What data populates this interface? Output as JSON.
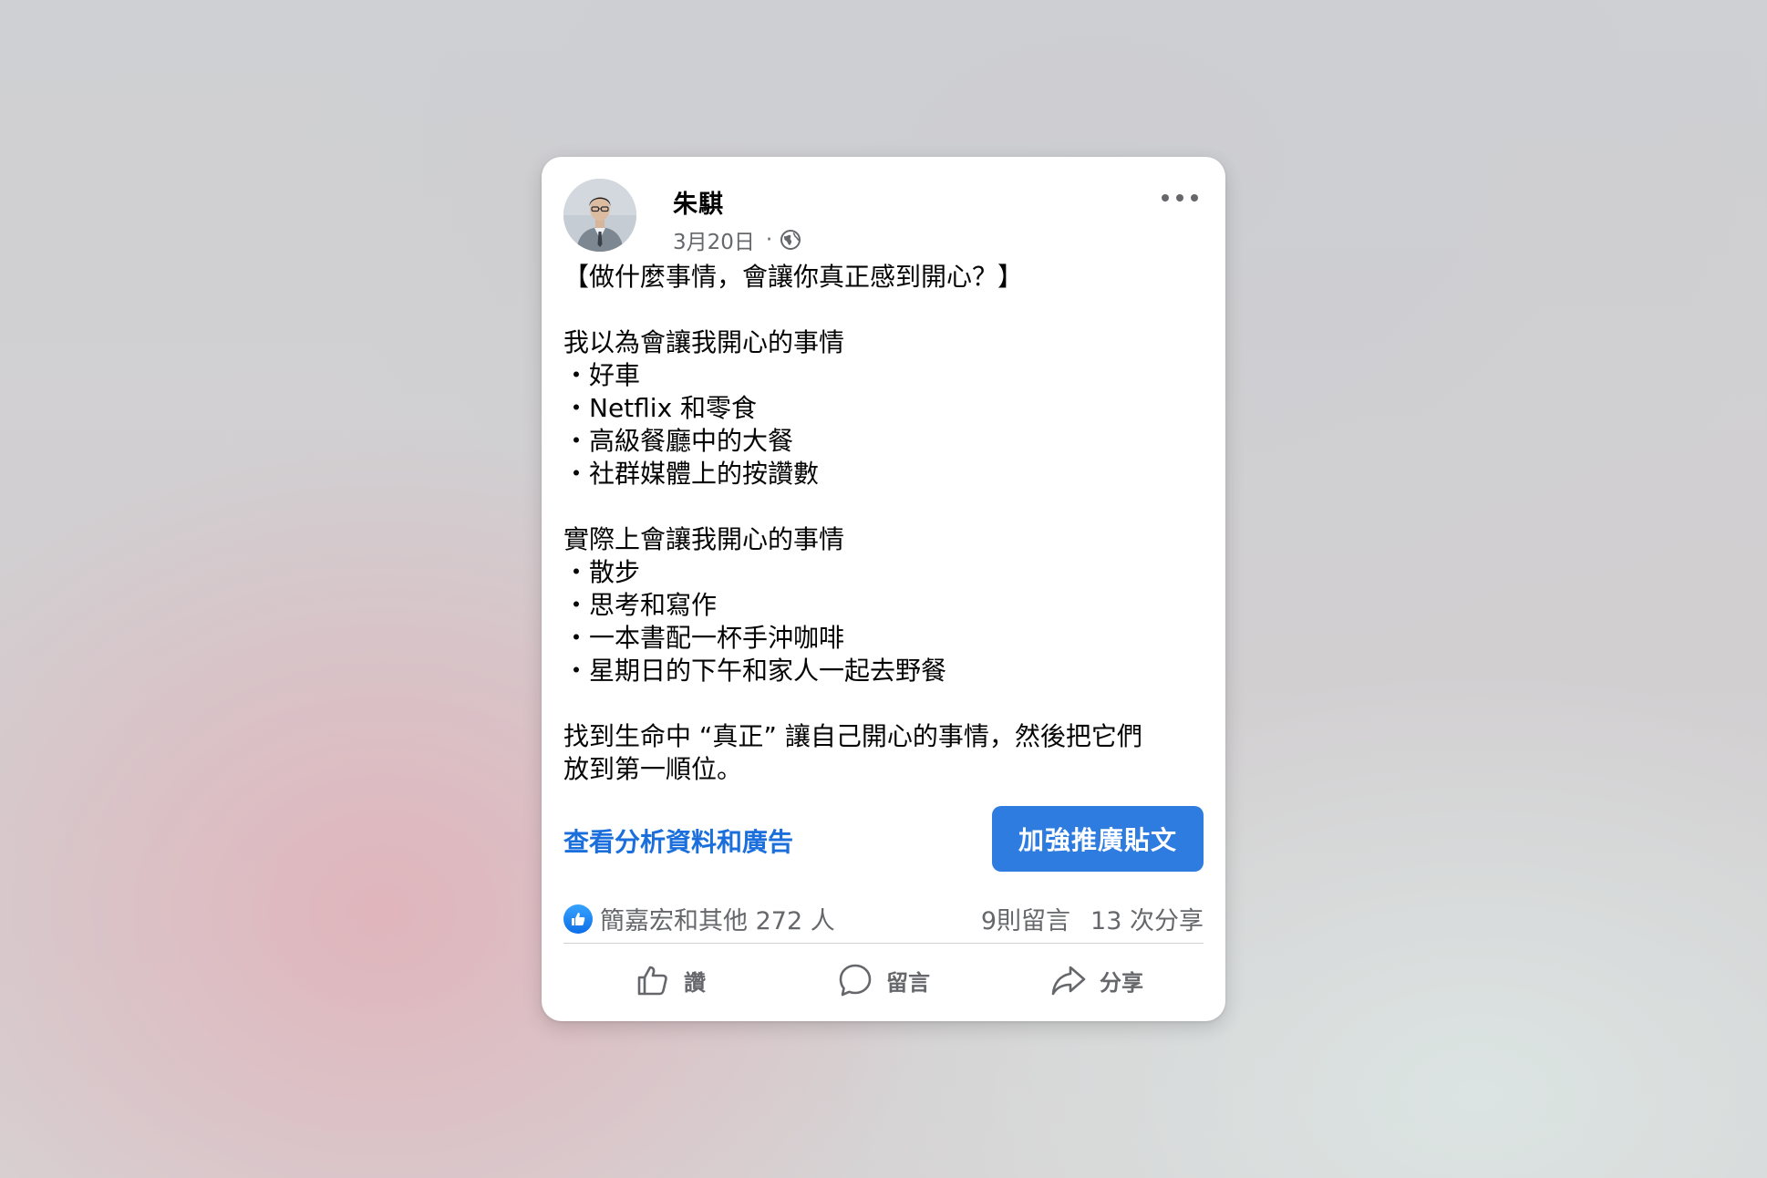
{
  "post": {
    "author": "朱騏",
    "date": "3月20日",
    "separator": "·",
    "privacy_icon": "globe-icon",
    "lines": [
      "【做什麼事情，會讓你真正感到開心？】",
      "",
      "我以為會讓我開心的事情",
      "・好車",
      "・Netflix 和零食",
      "・高級餐廳中的大餐",
      "・社群媒體上的按讚數",
      "",
      "實際上會讓我開心的事情",
      "・散步",
      "・思考和寫作",
      "・一本書配一杯手沖咖啡",
      "・星期日的下午和家人一起去野餐",
      "",
      "找到生命中 “真正” 讓自己開心的事情，然後把它們",
      "放到第一順位。"
    ]
  },
  "promo": {
    "insights_label": "查看分析資料和廣告",
    "boost_label": "加強推廣貼文"
  },
  "stats": {
    "reactions_label": "簡嘉宏和其他 272 人",
    "comments_label": "9則留言",
    "shares_label": "13 次分享"
  },
  "actions": {
    "like_label": "讚",
    "comment_label": "留言",
    "share_label": "分享"
  },
  "colors": {
    "accent": "#2f7ce0",
    "link": "#1b6fdc",
    "secondary_text": "#65676b"
  }
}
